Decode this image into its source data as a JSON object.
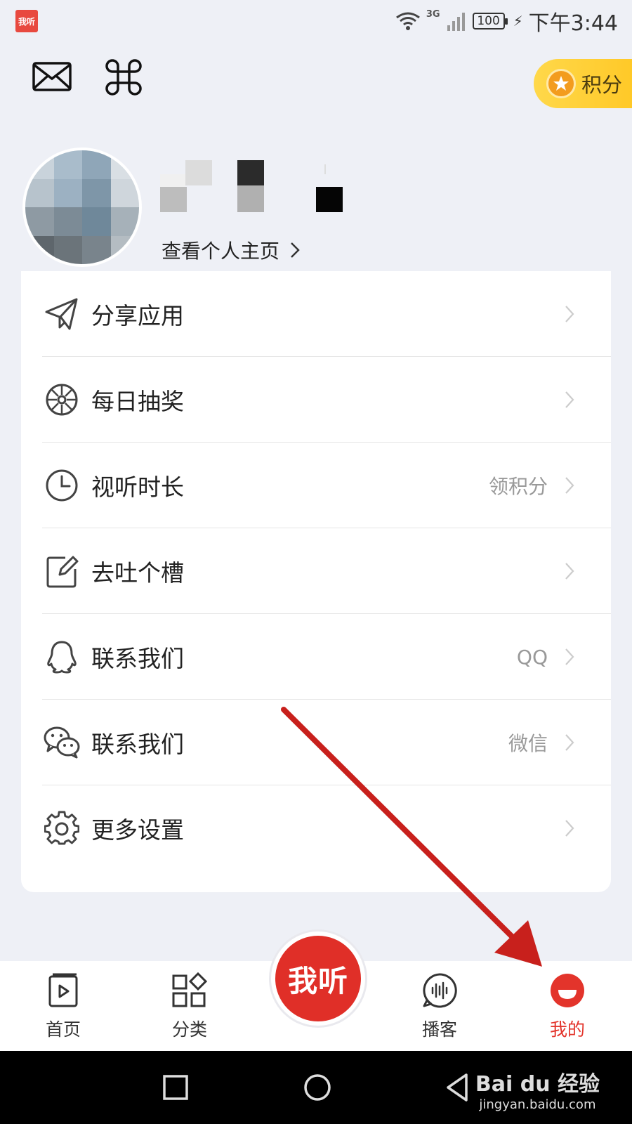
{
  "status_bar": {
    "app_badge": "我听",
    "network": "3G",
    "battery": "100",
    "time": "下午3:44"
  },
  "top_actions": {
    "mail_icon": "mail-icon",
    "command_icon": "command-icon",
    "points_label": "积分"
  },
  "profile": {
    "view_profile_label": "查看个人主页"
  },
  "menu": [
    {
      "icon": "share-icon",
      "label": "分享应用",
      "right": ""
    },
    {
      "icon": "lottery-icon",
      "label": "每日抽奖",
      "right": ""
    },
    {
      "icon": "clock-icon",
      "label": "视听时长",
      "right": "领积分"
    },
    {
      "icon": "edit-icon",
      "label": "去吐个槽",
      "right": ""
    },
    {
      "icon": "qq-icon",
      "label": "联系我们",
      "right": "QQ"
    },
    {
      "icon": "wechat-icon",
      "label": "联系我们",
      "right": "微信"
    },
    {
      "icon": "settings-icon",
      "label": "更多设置",
      "right": ""
    }
  ],
  "tabbar": {
    "home": "首页",
    "category": "分类",
    "center": "我听",
    "podcast": "播客",
    "mine": "我的"
  },
  "watermark": {
    "main": "Bai du 经验",
    "sub": "jingyan.baidu.com"
  },
  "colors": {
    "accent_red": "#e3342b",
    "points_yellow": "#ffc928",
    "annotation_arrow": "#c8201c"
  }
}
